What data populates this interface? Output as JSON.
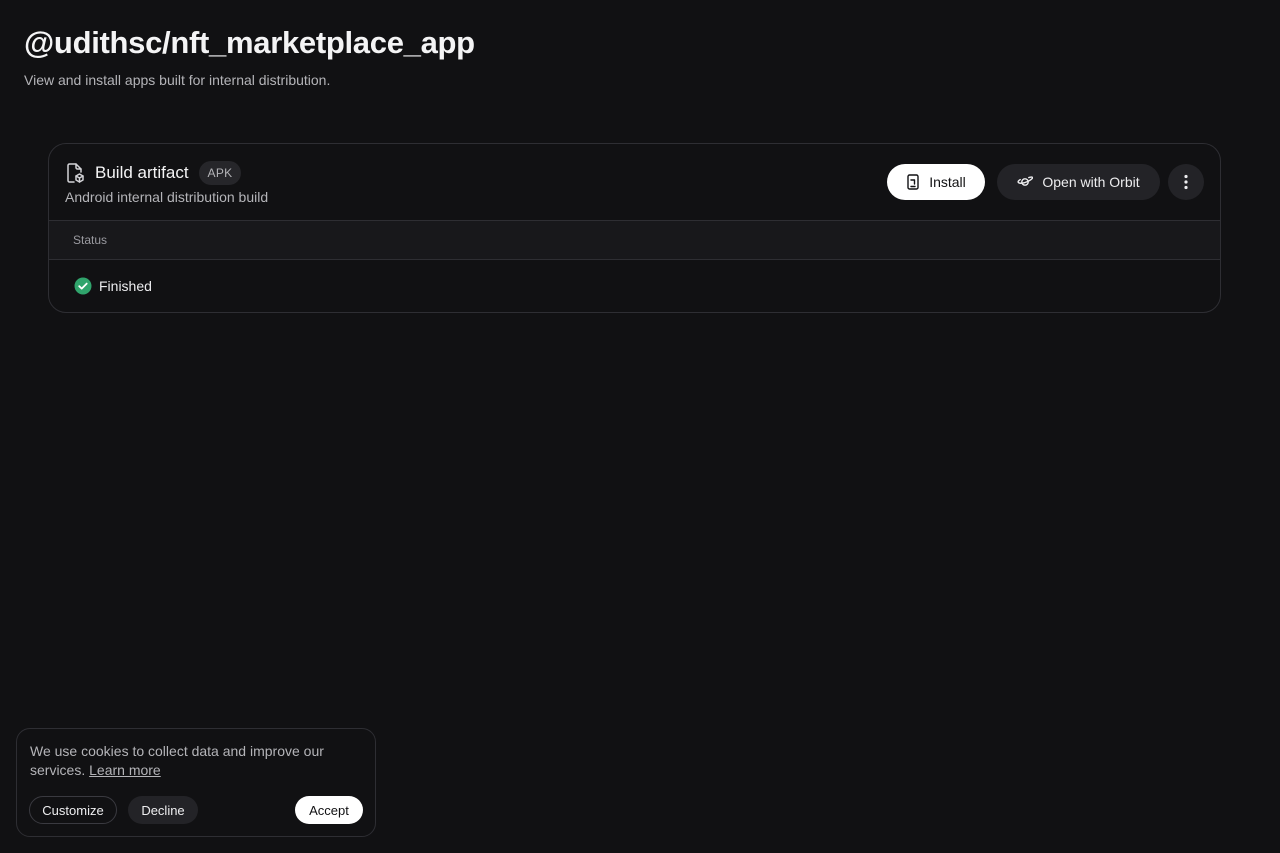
{
  "header": {
    "title": "@udithsc/nft_marketplace_app",
    "subtitle": "View and install apps built for internal distribution."
  },
  "artifact": {
    "icon": "file-package-icon",
    "title": "Build artifact",
    "badge": "APK",
    "description": "Android internal distribution build",
    "actions": {
      "install_label": "Install",
      "install_icon": "phone-download-icon",
      "orbit_label": "Open with Orbit",
      "orbit_icon": "orbit-icon",
      "more_icon": "more-vertical-icon"
    }
  },
  "table": {
    "columns": [
      "Status"
    ],
    "rows": [
      {
        "status": "Finished",
        "status_icon": "check-circle-icon",
        "status_color": "#30a46c"
      }
    ]
  },
  "cookie_banner": {
    "message": "We use cookies to collect data and improve our services.",
    "learn_more": "Learn more",
    "customize_label": "Customize",
    "decline_label": "Decline",
    "accept_label": "Accept"
  },
  "colors": {
    "background": "#111113",
    "border": "#2e2e33",
    "success": "#30a46c"
  }
}
